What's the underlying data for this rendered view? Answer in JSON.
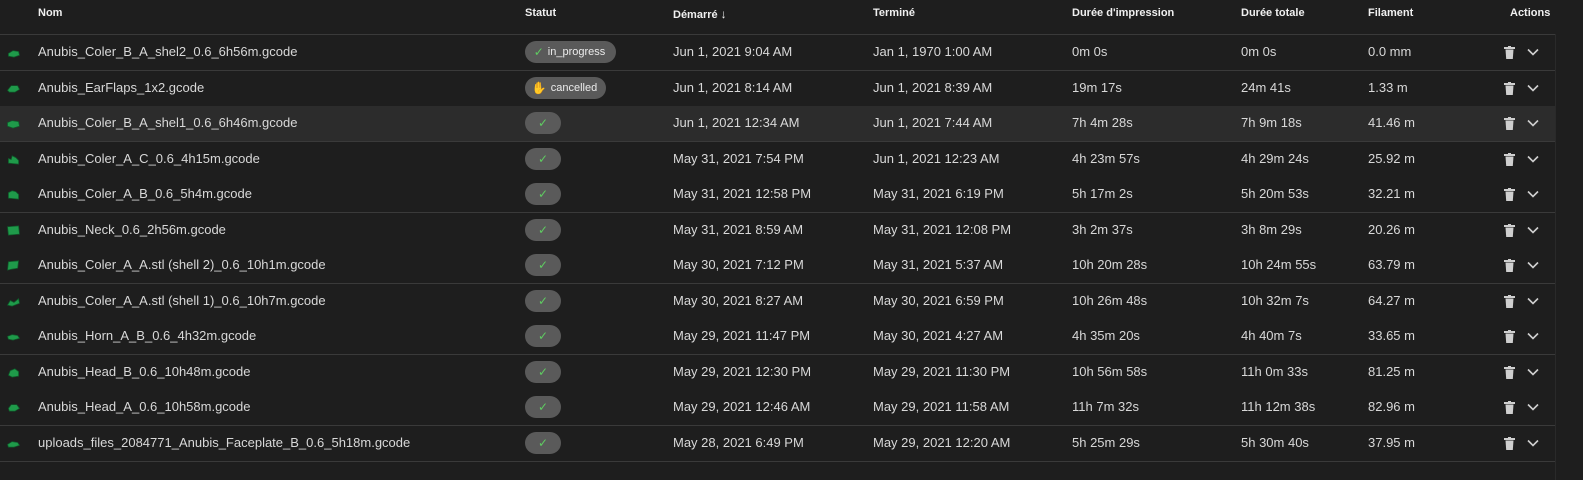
{
  "columns": {
    "name": "Nom",
    "status": "Statut",
    "started": "Démarré",
    "sort_icon": "arrow-down-icon",
    "ended": "Terminé",
    "print_duration": "Durée d'impression",
    "total_duration": "Durée totale",
    "filament": "Filament",
    "actions": "Actions"
  },
  "jobs": [
    {
      "name": "Anubis_Coler_B_A_shel2_0.6_6h56m.gcode",
      "status": "in_progress",
      "status_icon": "check-icon",
      "started": "Jun 1, 2021 9:04 AM",
      "ended": "Jan 1, 1970 1:00 AM",
      "print_duration": "0m 0s",
      "total_duration": "0m 0s",
      "filament": "0.0 mm"
    },
    {
      "name": "Anubis_EarFlaps_1x2.gcode",
      "status": "cancelled",
      "status_icon": "hand-icon",
      "started": "Jun 1, 2021 8:14 AM",
      "ended": "Jun 1, 2021 8:39 AM",
      "print_duration": "19m 17s",
      "total_duration": "24m 41s",
      "filament": "1.33 m"
    },
    {
      "name": "Anubis_Coler_B_A_shel1_0.6_6h46m.gcode",
      "status": "",
      "status_icon": "check-icon",
      "started": "Jun 1, 2021 12:34 AM",
      "ended": "Jun 1, 2021 7:44 AM",
      "print_duration": "7h 4m 28s",
      "total_duration": "7h 9m 18s",
      "filament": "41.46 m"
    },
    {
      "name": "Anubis_Coler_A_C_0.6_4h15m.gcode",
      "status": "",
      "status_icon": "check-icon",
      "started": "May 31, 2021 7:54 PM",
      "ended": "Jun 1, 2021 12:23 AM",
      "print_duration": "4h 23m 57s",
      "total_duration": "4h 29m 24s",
      "filament": "25.92 m"
    },
    {
      "name": "Anubis_Coler_A_B_0.6_5h4m.gcode",
      "status": "",
      "status_icon": "check-icon",
      "started": "May 31, 2021 12:58 PM",
      "ended": "May 31, 2021 6:19 PM",
      "print_duration": "5h 17m 2s",
      "total_duration": "5h 20m 53s",
      "filament": "32.21 m"
    },
    {
      "name": "Anubis_Neck_0.6_2h56m.gcode",
      "status": "",
      "status_icon": "check-icon",
      "started": "May 31, 2021 8:59 AM",
      "ended": "May 31, 2021 12:08 PM",
      "print_duration": "3h 2m 37s",
      "total_duration": "3h 8m 29s",
      "filament": "20.26 m"
    },
    {
      "name": "Anubis_Coler_A_A.stl (shell 2)_0.6_10h1m.gcode",
      "status": "",
      "status_icon": "check-icon",
      "started": "May 30, 2021 7:12 PM",
      "ended": "May 31, 2021 5:37 AM",
      "print_duration": "10h 20m 28s",
      "total_duration": "10h 24m 55s",
      "filament": "63.79 m"
    },
    {
      "name": "Anubis_Coler_A_A.stl (shell 1)_0.6_10h7m.gcode",
      "status": "",
      "status_icon": "check-icon",
      "started": "May 30, 2021 8:27 AM",
      "ended": "May 30, 2021 6:59 PM",
      "print_duration": "10h 26m 48s",
      "total_duration": "10h 32m 7s",
      "filament": "64.27 m"
    },
    {
      "name": "Anubis_Horn_A_B_0.6_4h32m.gcode",
      "status": "",
      "status_icon": "check-icon",
      "started": "May 29, 2021 11:47 PM",
      "ended": "May 30, 2021 4:27 AM",
      "print_duration": "4h 35m 20s",
      "total_duration": "4h 40m 7s",
      "filament": "33.65 m"
    },
    {
      "name": "Anubis_Head_B_0.6_10h48m.gcode",
      "status": "",
      "status_icon": "check-icon",
      "started": "May 29, 2021 12:30 PM",
      "ended": "May 29, 2021 11:30 PM",
      "print_duration": "10h 56m 58s",
      "total_duration": "11h 0m 33s",
      "filament": "81.25 m"
    },
    {
      "name": "Anubis_Head_A_0.6_10h58m.gcode",
      "status": "",
      "status_icon": "check-icon",
      "started": "May 29, 2021 12:46 AM",
      "ended": "May 29, 2021 11:58 AM",
      "print_duration": "11h 7m 32s",
      "total_duration": "11h 12m 38s",
      "filament": "82.96 m"
    },
    {
      "name": "uploads_files_2084771_Anubis_Faceplate_B_0.6_5h18m.gcode",
      "status": "",
      "status_icon": "check-icon",
      "started": "May 28, 2021 6:49 PM",
      "ended": "May 29, 2021 12:20 AM",
      "print_duration": "5h 25m 29s",
      "total_duration": "5h 30m 40s",
      "filament": "37.95 m"
    }
  ],
  "row_icons": {
    "delete": "trash-icon",
    "expand": "chevron-down-icon",
    "thumbnail": "model-thumbnail-icon"
  },
  "colors": {
    "background": "#1e1e1e",
    "row_highlight": "#2c2c2c",
    "chip": "#5a5a5a",
    "success": "#5fcc61",
    "cancel": "#e05050",
    "thumbnail": "#1f9a4a"
  }
}
